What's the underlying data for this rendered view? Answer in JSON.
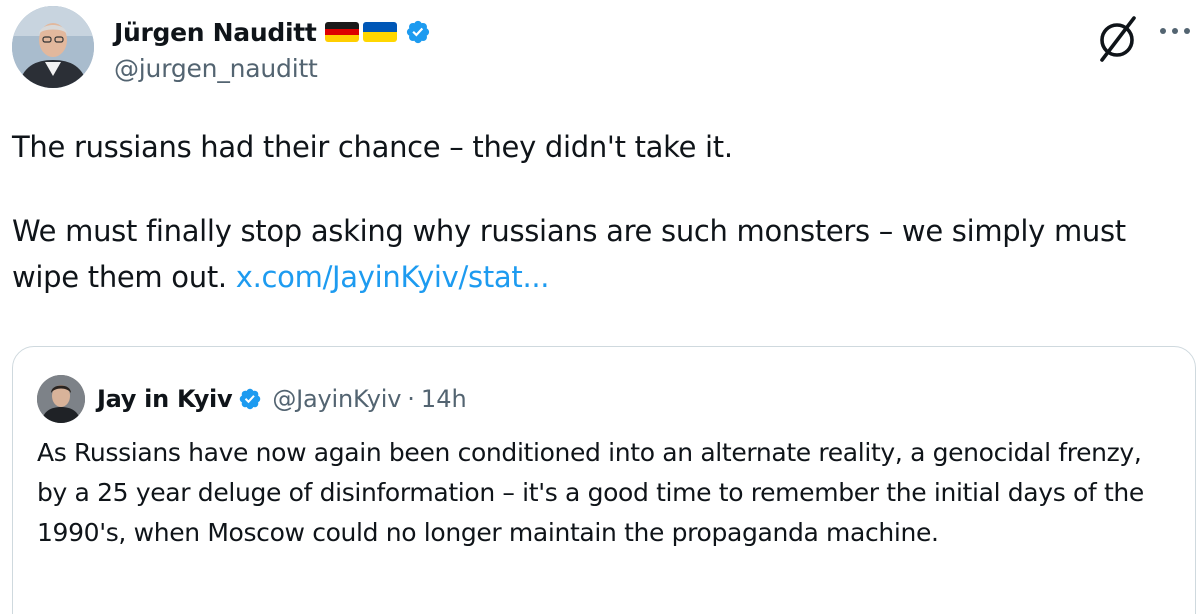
{
  "author": {
    "display_name": "Jürgen Nauditt",
    "handle": "@jurgen_nauditt",
    "flags": [
      "germany-flag",
      "ukraine-flag"
    ],
    "verified": true
  },
  "tweet": {
    "paragraph1": "The russians had their chance – they didn't take it.",
    "paragraph2": "We must finally stop asking why russians are such monsters – we simply must wipe them out.",
    "link_text": "x.com/JayinKyiv/stat..."
  },
  "quoted": {
    "display_name": "Jay in Kyiv",
    "handle": "@JayinKyiv",
    "separator": "·",
    "time": "14h",
    "verified": true,
    "text": "As Russians have now again been conditioned into an alternate reality, a genocidal frenzy, by a 25 year deluge of disinformation – it's a good time to remember the initial days of the 1990's, when Moscow could no longer maintain the propaganda machine."
  },
  "icons": {
    "top_right": [
      "grok-slash-icon",
      "more-icon"
    ]
  },
  "colors": {
    "text": "#0f1419",
    "secondary": "#536471",
    "link": "#1d9bf0",
    "verified": "#1d9bf0",
    "border": "#cfd9de"
  }
}
